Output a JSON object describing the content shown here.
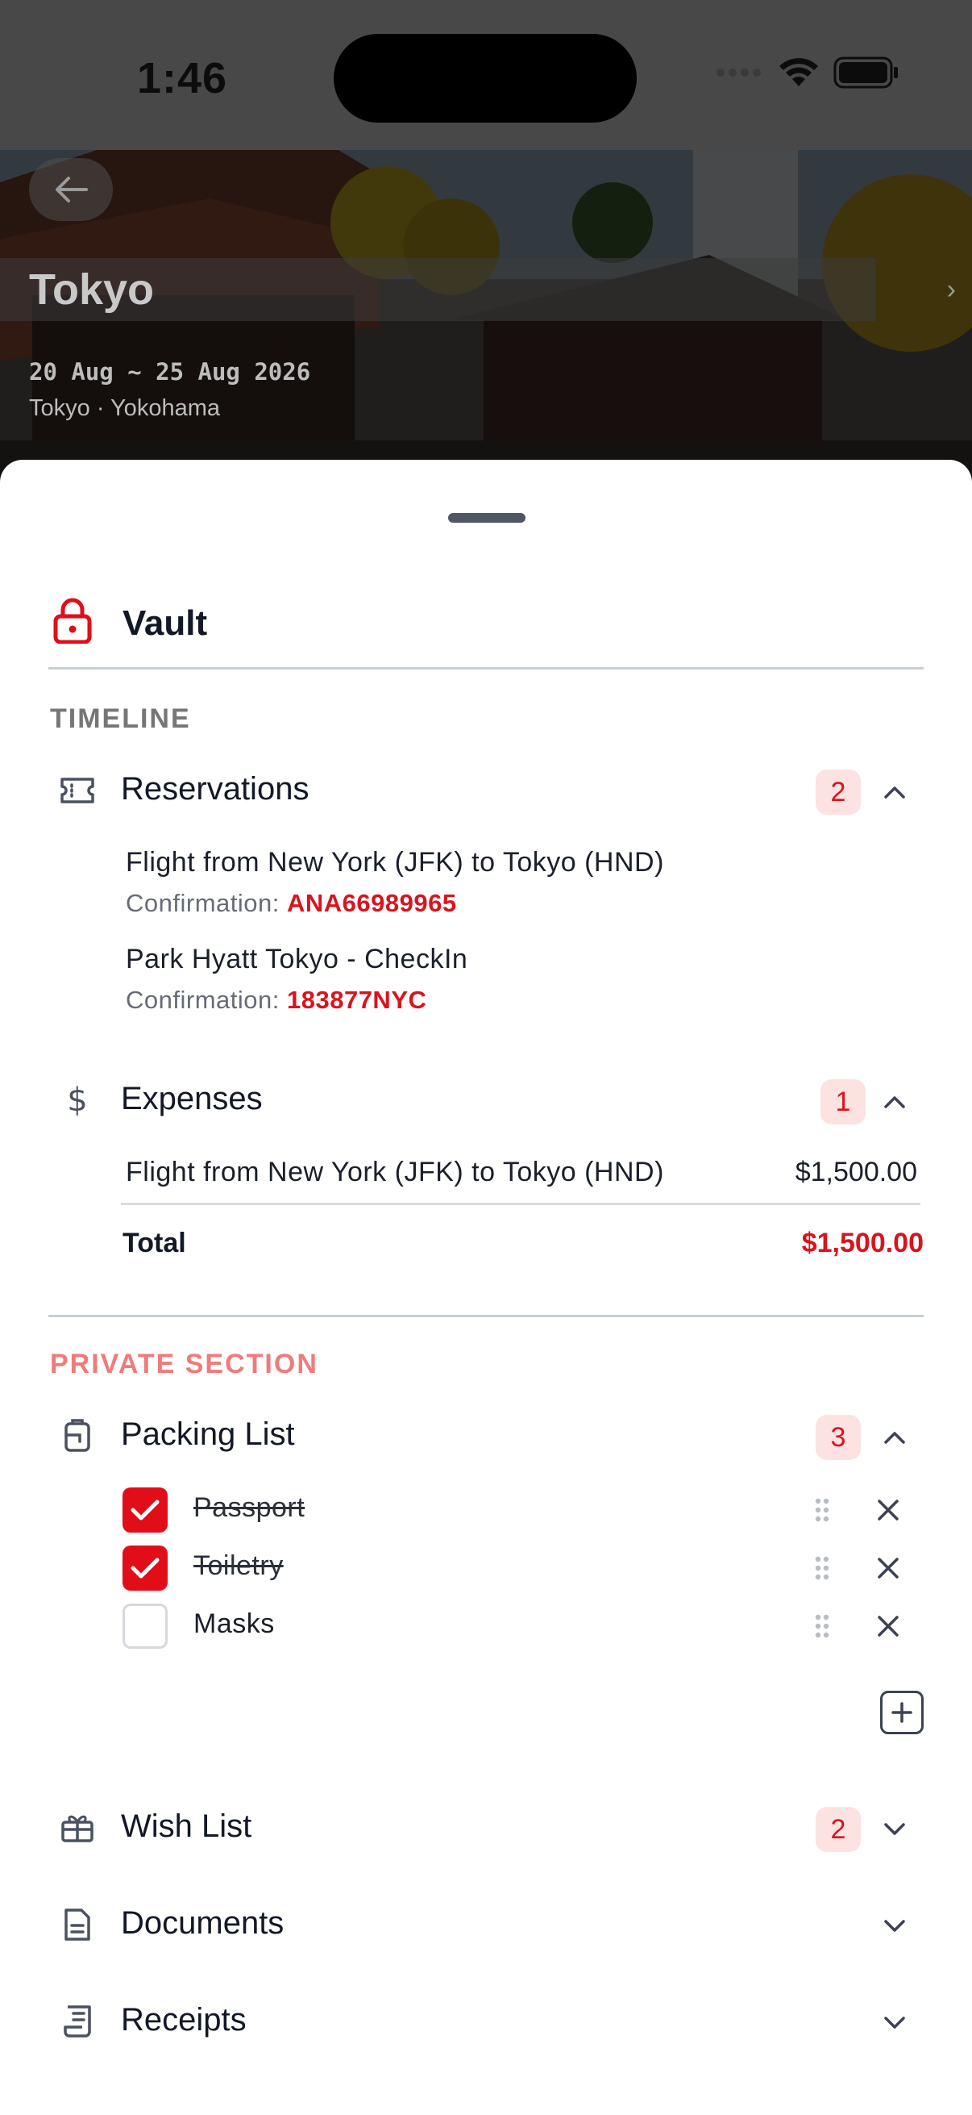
{
  "status_bar": {
    "time": "1:46"
  },
  "trip": {
    "title": "Tokyo",
    "dates": "20 Aug ~ 25 Aug 2026",
    "cities": "Tokyo · Yokohama"
  },
  "vault": {
    "title": "Vault",
    "accent_color": "#e10e1a"
  },
  "timeline": {
    "label": "TIMELINE",
    "reservations": {
      "title": "Reservations",
      "count": "2",
      "items": [
        {
          "title": "Flight from New York (JFK) to Tokyo (HND)",
          "conf_label": "Confirmation:",
          "conf_code": "ANA66989965"
        },
        {
          "title": "Park Hyatt Tokyo - CheckIn",
          "conf_label": "Confirmation:",
          "conf_code": "183877NYC"
        }
      ]
    },
    "expenses": {
      "title": "Expenses",
      "count": "1",
      "items": [
        {
          "name": "Flight from New York (JFK) to Tokyo (HND)",
          "amount": "$1,500.00"
        }
      ],
      "total_label": "Total",
      "total_amount": "$1,500.00"
    }
  },
  "private_section": {
    "label": "PRIVATE SECTION",
    "packing_list": {
      "title": "Packing List",
      "count": "3",
      "items": [
        {
          "label": "Passport",
          "checked": true
        },
        {
          "label": "Toiletry",
          "checked": true
        },
        {
          "label": "Masks",
          "checked": false
        }
      ]
    },
    "wish_list": {
      "title": "Wish List",
      "count": "2"
    },
    "documents": {
      "title": "Documents"
    },
    "receipts": {
      "title": "Receipts"
    }
  }
}
